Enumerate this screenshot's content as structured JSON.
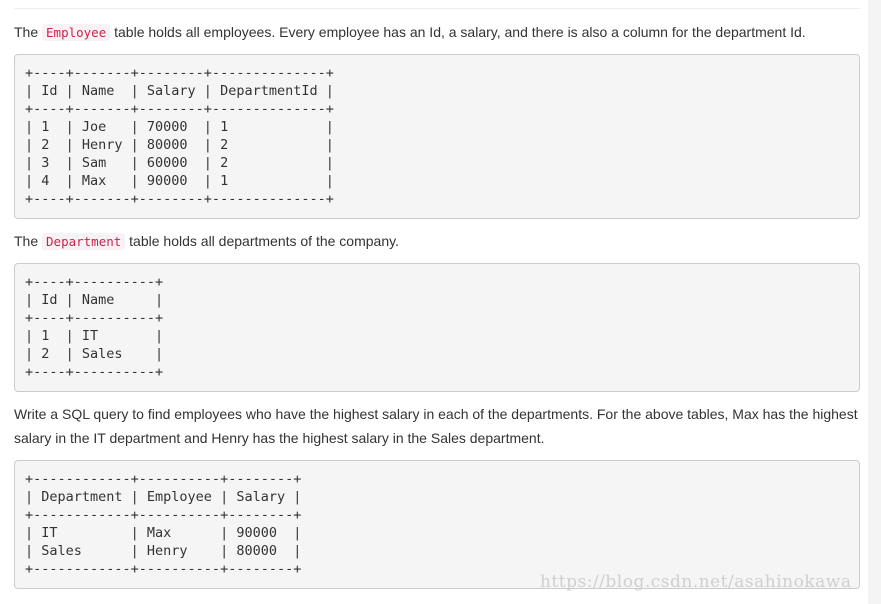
{
  "intro": {
    "before": "The ",
    "code": "Employee",
    "after": " table holds all employees. Every employee has an Id, a salary, and there is also a column for the department Id."
  },
  "employee_table": "+----+-------+--------+--------------+\n| Id | Name  | Salary | DepartmentId |\n+----+-------+--------+--------------+\n| 1  | Joe   | 70000  | 1            |\n| 2  | Henry | 80000  | 2            |\n| 3  | Sam   | 60000  | 2            |\n| 4  | Max   | 90000  | 1            |\n+----+-------+--------+--------------+",
  "department_intro": {
    "before": "The ",
    "code": "Department",
    "after": " table holds all departments of the company."
  },
  "department_table": "+----+----------+\n| Id | Name     |\n+----+----------+\n| 1  | IT       |\n| 2  | Sales    |\n+----+----------+",
  "task_text": "Write a SQL query to find employees who have the highest salary in each of the departments. For the above tables, Max has the highest salary in the IT department and Henry has the highest salary in the Sales department.",
  "result_table": "+------------+----------+--------+\n| Department | Employee | Salary |\n+------------+----------+--------+\n| IT         | Max      | 90000  |\n| Sales      | Henry    | 80000  |\n+------------+----------+--------+",
  "watermark": "https://blog.csdn.net/asahinokawa"
}
